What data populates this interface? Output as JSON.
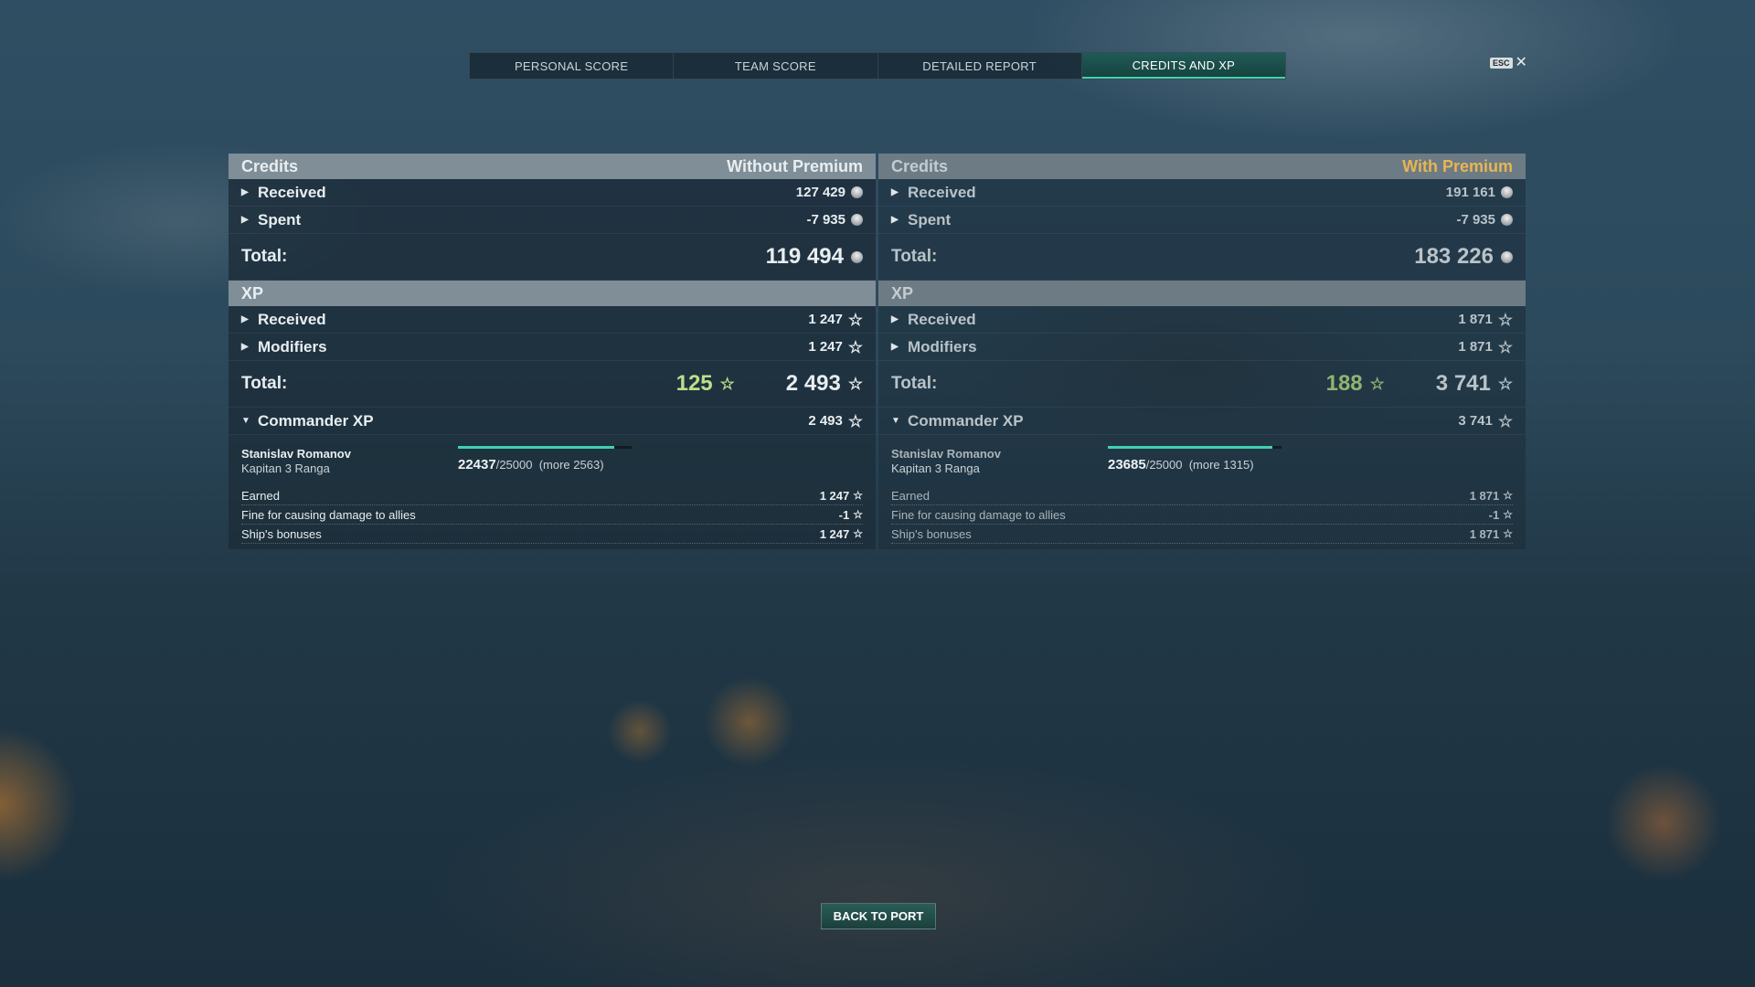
{
  "tabs": [
    "PERSONAL SCORE",
    "TEAM SCORE",
    "DETAILED REPORT",
    "CREDITS AND XP"
  ],
  "active_tab": "CREDITS AND XP",
  "esc_label": "ESC",
  "colors": {
    "accent": "#3fd1b0",
    "premium_gold": "#e7b553",
    "xp_green": "#b9e08a"
  },
  "left": {
    "credits_title": "Credits",
    "column_label": "Without Premium",
    "credits_received_label": "Received",
    "credits_received": "127 429",
    "credits_spent_label": "Spent",
    "credits_spent": "-7 935",
    "credits_total_label": "Total:",
    "credits_total": "119 494",
    "xp_title": "XP",
    "xp_received_label": "Received",
    "xp_received": "1 247",
    "xp_modifiers_label": "Modifiers",
    "xp_modifiers": "1 247",
    "xp_total_label": "Total:",
    "xp_free": "125",
    "xp_total": "2 493",
    "commander_xp_label": "Commander XP",
    "commander_xp": "2 493",
    "commander_name": "Stanislav Romanov",
    "commander_rank": "Kapitan 3 Ranga",
    "progress_current": "22437",
    "progress_max": "/25000",
    "progress_more": "(more 2563)",
    "progress_fraction": 0.8975,
    "earned_label": "Earned",
    "earned": "1 247",
    "fine_label": "Fine for causing damage to allies",
    "fine": "-1",
    "bonus_label": "Ship's bonuses",
    "bonus": "1 247"
  },
  "right": {
    "credits_title": "Credits",
    "column_label": "With Premium",
    "credits_received_label": "Received",
    "credits_received": "191 161",
    "credits_spent_label": "Spent",
    "credits_spent": "-7 935",
    "credits_total_label": "Total:",
    "credits_total": "183 226",
    "xp_title": "XP",
    "xp_received_label": "Received",
    "xp_received": "1 871",
    "xp_modifiers_label": "Modifiers",
    "xp_modifiers": "1 871",
    "xp_total_label": "Total:",
    "xp_free": "188",
    "xp_total": "3 741",
    "commander_xp_label": "Commander XP",
    "commander_xp": "3 741",
    "commander_name": "Stanislav Romanov",
    "commander_rank": "Kapitan 3 Ranga",
    "progress_current": "23685",
    "progress_max": "/25000",
    "progress_more": "(more 1315)",
    "progress_fraction": 0.9474,
    "earned_label": "Earned",
    "earned": "1 871",
    "fine_label": "Fine for causing damage to allies",
    "fine": "-1",
    "bonus_label": "Ship's bonuses",
    "bonus": "1 871"
  },
  "back_button": "BACK TO PORT"
}
